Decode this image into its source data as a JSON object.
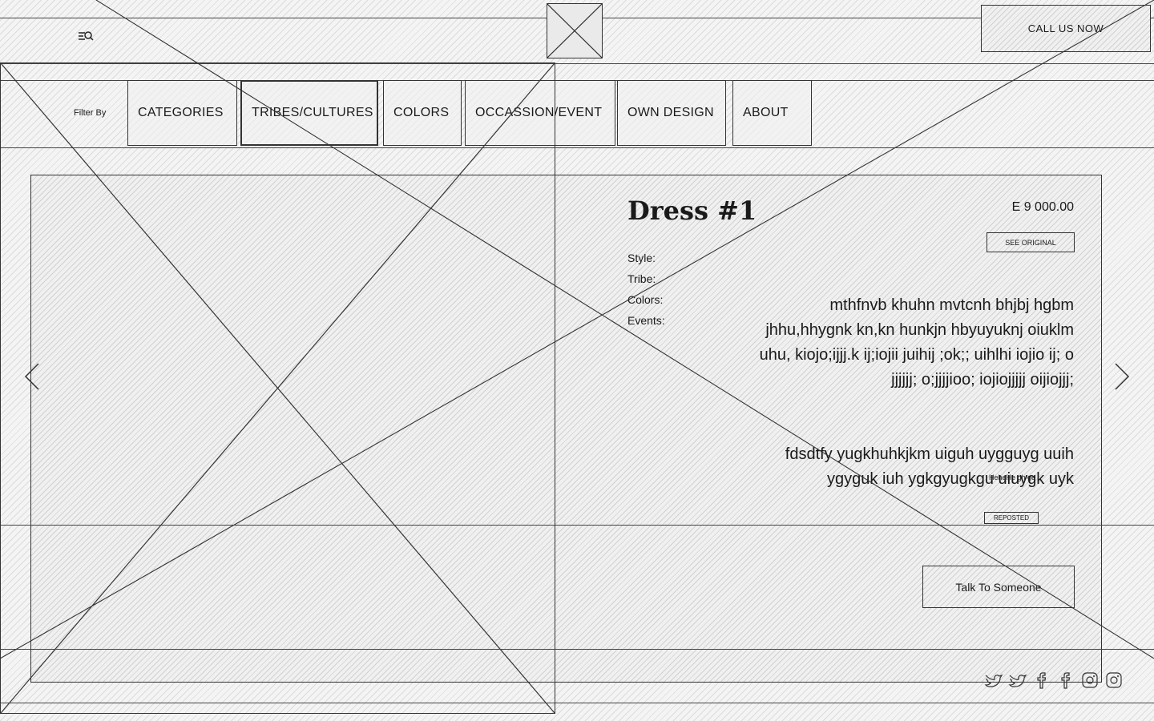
{
  "header": {
    "menu_icon": "menu-search-icon",
    "logo": "logo-placeholder",
    "cta_label": "CALL US NOW"
  },
  "filter": {
    "label": "Filter By",
    "tabs": [
      {
        "label": "CATEGORIES"
      },
      {
        "label": "TRIBES/CULTURES"
      },
      {
        "label": "COLORS"
      },
      {
        "label": "OCCASSION/EVENT"
      },
      {
        "label": "OWN DESIGN"
      },
      {
        "label": "ABOUT"
      }
    ]
  },
  "product": {
    "title": "Dress #1",
    "price": "E 9 000.00",
    "see_original_label": "SEE ORIGINAL",
    "attributes": {
      "style": "Style:",
      "tribe": "Tribe:",
      "colors": "Colors:",
      "events": "Events:"
    },
    "description_1": "mthfnvb khuhn mvtcnh bhjbj hgbm jhhu,hhygnk kn,kn hunkjn hbyuyuknj oiuklm uhu, kiojo;ijjj.k ij;iojii juihij ;ok;; uihlhi iojio ij; o jjjjjj; o;jjjjioo; iojiojjjjj oijiojjj;",
    "description_2": "fdsdtfy yugkhuhkjkm uiguh uygguyg uuih ygyguk iuh ygkgyugkgu uiuygk uyk",
    "small_note": "HeheHe gh ge",
    "reposted_label": "REPOSTED",
    "talk_label": "Talk To Someone"
  },
  "footer": {
    "social_icons": [
      "twitter-icon",
      "twitter-icon",
      "facebook-icon",
      "facebook-icon",
      "instagram-icon",
      "instagram-icon"
    ]
  }
}
